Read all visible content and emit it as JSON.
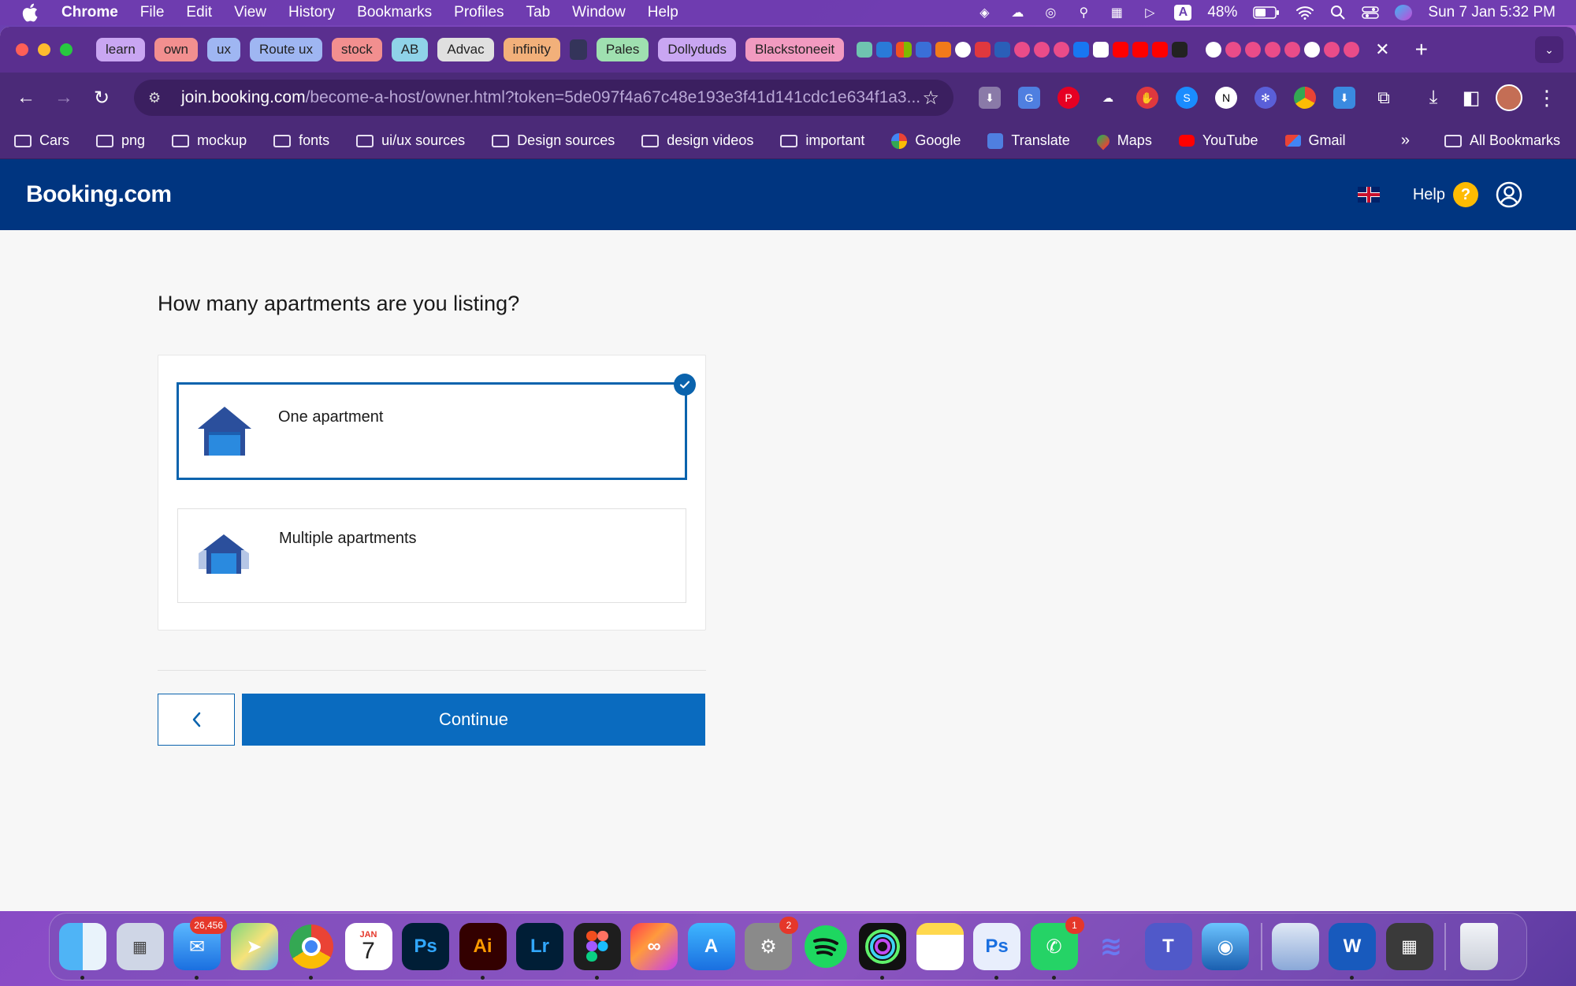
{
  "menubar": {
    "app_name": "Chrome",
    "items": [
      "File",
      "Edit",
      "View",
      "History",
      "Bookmarks",
      "Profiles",
      "Tab",
      "Window",
      "Help"
    ],
    "battery": "48%",
    "datetime": "Sun 7 Jan  5:32 PM"
  },
  "tabs": [
    {
      "label": "learn",
      "color": "#c9a6f2"
    },
    {
      "label": "own",
      "color": "#f28f8f"
    },
    {
      "label": "ux",
      "color": "#9fb6f2"
    },
    {
      "label": "Route ux",
      "color": "#9fb6f2"
    },
    {
      "label": "stock",
      "color": "#f28f8f"
    },
    {
      "label": "AB",
      "color": "#8fd3e8"
    },
    {
      "label": "Advac",
      "color": "#e0e0e0"
    },
    {
      "label": "infinity",
      "color": "#f2b07a"
    },
    {
      "label": "Pales",
      "color": "#9fe0b0"
    },
    {
      "label": "Dollyduds",
      "color": "#c9a6f2"
    },
    {
      "label": "Blackstoneeit",
      "color": "#f29ac0"
    }
  ],
  "address_bar": {
    "host": "join.booking.com",
    "path": "/become-a-host/owner.html?token=5de097f4a67c48e193e3f41d141cdc1e634f1a3..."
  },
  "bookmarks": {
    "items": [
      {
        "label": "Cars",
        "type": "folder"
      },
      {
        "label": "png",
        "type": "folder"
      },
      {
        "label": "mockup",
        "type": "folder"
      },
      {
        "label": "fonts",
        "type": "folder"
      },
      {
        "label": "ui/ux sources",
        "type": "folder"
      },
      {
        "label": "Design sources",
        "type": "folder"
      },
      {
        "label": "design videos",
        "type": "folder"
      },
      {
        "label": "important",
        "type": "folder"
      },
      {
        "label": "Google",
        "type": "link"
      },
      {
        "label": "Translate",
        "type": "link"
      },
      {
        "label": "Maps",
        "type": "link"
      },
      {
        "label": "YouTube",
        "type": "link"
      },
      {
        "label": "Gmail",
        "type": "link"
      }
    ],
    "all_bookmarks": "All Bookmarks"
  },
  "booking": {
    "logo": "Booking.com",
    "help_label": "Help",
    "help_icon_glyph": "?",
    "question": "How many apartments are you listing?",
    "options": [
      {
        "label": "One apartment",
        "selected": true
      },
      {
        "label": "Multiple apartments",
        "selected": false
      }
    ],
    "back_glyph": "‹",
    "continue_label": "Continue",
    "brand_color": "#003580",
    "accent_color": "#0a6bbf"
  },
  "dock": {
    "mail_badge": "26,456",
    "calendar_month": "JAN",
    "calendar_day": "7",
    "settings_badge": "2",
    "whatsapp_badge": "1",
    "photoshop_label": "Ps",
    "illustrator_label": "Ai",
    "lightroom_label": "Lr",
    "photoshop2_label": "Ps"
  }
}
